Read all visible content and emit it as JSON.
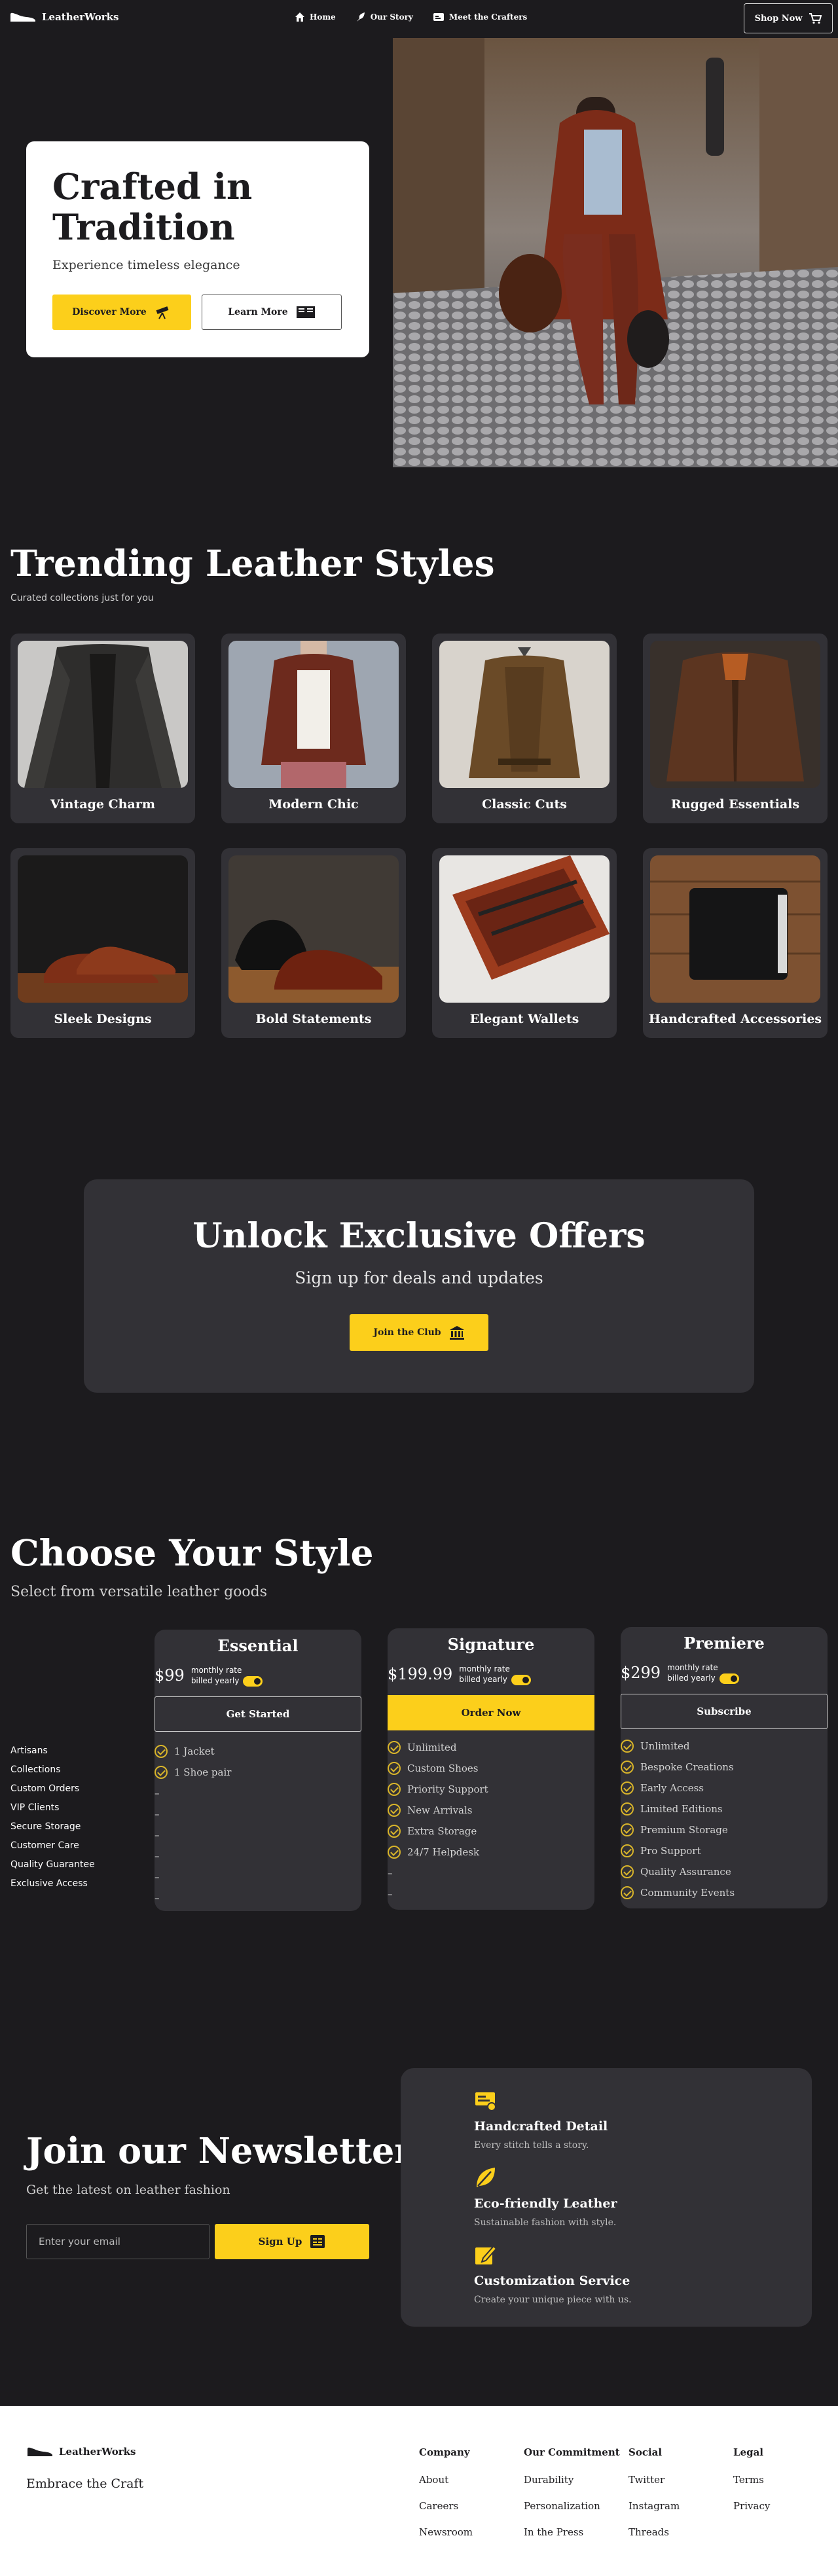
{
  "nav": {
    "brand": "LeatherWorks",
    "links": [
      "Home",
      "Our Story",
      "Meet the Crafters"
    ],
    "shop_label": "Shop Now"
  },
  "hero": {
    "title": "Crafted in Tradition",
    "subtitle": "Experience timeless elegance",
    "primary_label": "Discover More",
    "secondary_label": "Learn More"
  },
  "trending": {
    "title": "Trending Leather Styles",
    "subtitle": "Curated collections just for you",
    "items": [
      "Vintage Charm",
      "Modern Chic",
      "Classic Cuts",
      "Rugged Essentials",
      "Sleek Designs",
      "Bold Statements",
      "Elegant Wallets",
      "Handcrafted Accessories"
    ]
  },
  "offers": {
    "title": "Unlock Exclusive Offers",
    "subtitle": "Sign up for deals and updates",
    "button_label": "Join the Club"
  },
  "pricing": {
    "title": "Choose Your Style",
    "subtitle": "Select from versatile leather goods",
    "features": [
      "Artisans",
      "Collections",
      "Custom Orders",
      "VIP Clients",
      "Secure Storage",
      "Customer Care",
      "Quality Guarantee",
      "Exclusive Access"
    ],
    "plans": [
      {
        "name": "Essential",
        "price": "$99",
        "rate": "monthly rate",
        "billing": "billed yearly",
        "button": "Get Started",
        "items": [
          "1 Jacket",
          "1 Shoe pair",
          "–",
          "–",
          "–",
          "–",
          "–",
          "–"
        ]
      },
      {
        "name": "Signature",
        "price": "$199.99",
        "rate": "monthly rate",
        "billing": "billed yearly",
        "button": "Order Now",
        "items": [
          "Unlimited",
          "Custom Shoes",
          "Priority Support",
          "New Arrivals",
          "Extra Storage",
          "24/7 Helpdesk",
          "–",
          "–"
        ]
      },
      {
        "name": "Premiere",
        "price": "$299",
        "rate": "monthly rate",
        "billing": "billed yearly",
        "button": "Subscribe",
        "items": [
          "Unlimited",
          "Bespoke Creations",
          "Early Access",
          "Limited Editions",
          "Premium Storage",
          "Pro Support",
          "Quality Assurance",
          "Community Events"
        ]
      }
    ]
  },
  "newsletter": {
    "title": "Join our Newsletter",
    "subtitle": "Get the latest on leather fashion",
    "placeholder": "Enter your email",
    "button_label": "Sign Up",
    "features": [
      {
        "title": "Handcrafted Detail",
        "desc": "Every stitch tells a story."
      },
      {
        "title": "Eco-friendly Leather",
        "desc": "Sustainable fashion with style."
      },
      {
        "title": "Customization Service",
        "desc": "Create your unique piece with us."
      }
    ]
  },
  "footer": {
    "brand": "LeatherWorks",
    "tagline": "Embrace the Craft",
    "columns": [
      {
        "heading": "Company",
        "items": [
          "About",
          "Careers",
          "Newsroom"
        ]
      },
      {
        "heading": "Our Commitment",
        "items": [
          "Durability",
          "Personalization",
          "In the Press"
        ]
      },
      {
        "heading": "Social",
        "items": [
          "Twitter",
          "Instagram",
          "Threads"
        ]
      },
      {
        "heading": "Legal",
        "items": [
          "Terms",
          "Privacy"
        ]
      }
    ]
  },
  "colors": {
    "accent": "#fccf1b",
    "background": "#1c1b1e",
    "card": "#323136"
  }
}
